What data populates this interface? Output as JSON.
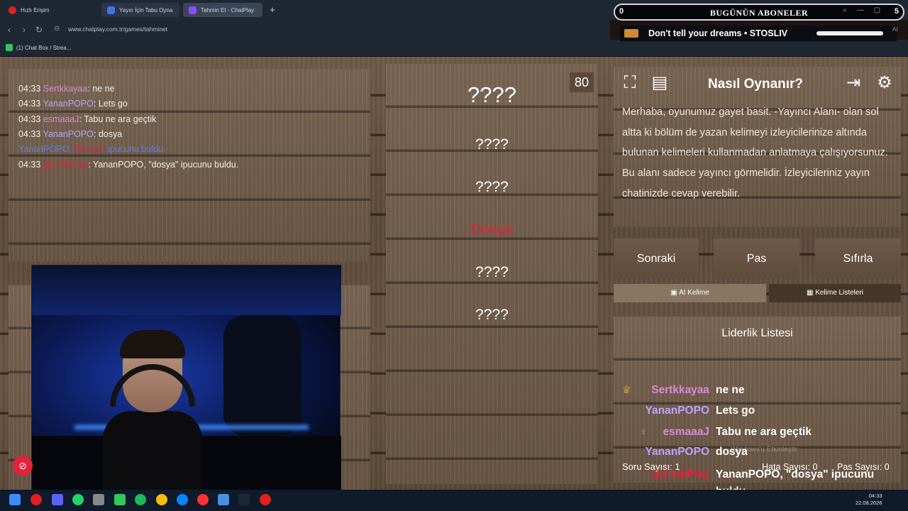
{
  "browser": {
    "tabs": [
      {
        "label": "Hızlı Erişim"
      },
      {
        "label": "Yayın İçin Tabu Oyna"
      },
      {
        "label": "Tahmin Et - ChatPlay"
      }
    ],
    "new_tab": "+",
    "url": "www.chatplay.com.tr/games/tahminet",
    "bookmark": "(1) Chat Box / Strea..."
  },
  "overlay": {
    "subs_count": "0",
    "subs_title": "BUGÜNÜN ABONELER",
    "subs_right": "5",
    "song": "Don't tell your dreams  •  STOSLIV",
    "ai_badge": "AI"
  },
  "chat": {
    "lines": [
      {
        "time": "04:33",
        "user": "Sertkkayaa",
        "msg": ": ne ne"
      },
      {
        "time": "04:33",
        "user": "YananPOPO",
        "msg": ": Lets go"
      },
      {
        "time": "04:33",
        "user": "esmaaaJ",
        "msg": ": Tabu ne ara geçtik"
      },
      {
        "time": "04:33",
        "user": "YananPOPO",
        "msg": ": dosya"
      },
      {
        "sys_user": "YananPOPO,",
        "sys_word": "\"Dosya\"",
        "sys_msg": "ipucunu buldu."
      },
      {
        "time": "04:33",
        "user": "@ChatPlay",
        "msg": ": YananPOPO, \"dosya\" ipucunu buldu."
      }
    ]
  },
  "game": {
    "score": "80",
    "words": [
      "????",
      "????",
      "????",
      "Dosya",
      "????",
      "????"
    ]
  },
  "howto": {
    "title": "Nasıl Oynanır?",
    "text": "Merhaba, oyunumuz gayet basit. -Yayıncı Alanı- olan sol altta ki bölüm de yazan kelimeyi izleyicilerinize altında bulunan kelimeleri kullanmadan anlatmaya çalışıyorsunuz. Bu alanı sadece yayıncı görmelidir. İzleyicileriniz yayın chatinizde cevap verebilir."
  },
  "buttons": {
    "next": "Sonraki",
    "pass": "Pas",
    "reset": "Sıfırla"
  },
  "subtabs": {
    "ai": "AI Kelime",
    "lists": "Kelime Listeleri"
  },
  "leaderboard": {
    "title": "Liderlik Listesi",
    "rows": [
      {
        "user": "Sertkkayaa",
        "msg": "ne ne"
      },
      {
        "user": "YananPOPO",
        "msg": "Lets go"
      },
      {
        "user": "esmaaaJ",
        "msg": "Tabu ne ara geçtik"
      },
      {
        "user": "YananPOPO",
        "msg": "dosya"
      },
      {
        "user": "@ChatPlay",
        "msg": "YananPOPO, \"dosya\" ipucunu buldu."
      }
    ],
    "stats_left": "Soru Sayısı: 1",
    "stats_mid": "Hata Sayısı: 0",
    "stats_right": "Pas Sayısı: 0",
    "watermark": "Windows'u Etkinleştir"
  },
  "taskbar": {
    "time": "04:33",
    "date": "22.08.2026"
  },
  "colors": {
    "accent_red": "#e0223a",
    "user_pink": "#d88ad8",
    "user_purple": "#b9a2ff"
  }
}
